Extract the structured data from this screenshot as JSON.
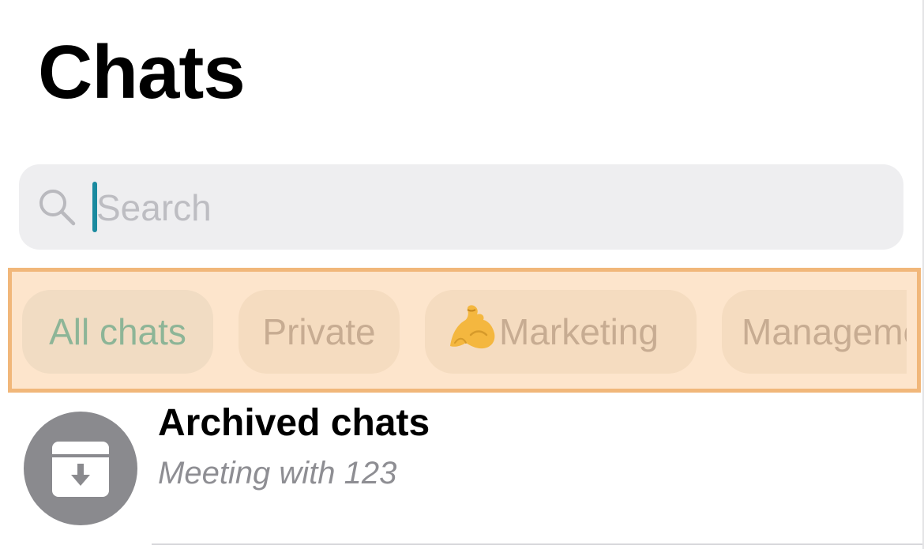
{
  "header": {
    "title": "Chats"
  },
  "search": {
    "placeholder": "Search",
    "value": ""
  },
  "filters": {
    "items": [
      {
        "label": "All chats",
        "active": true,
        "icon": ""
      },
      {
        "label": "Private",
        "active": false,
        "icon": ""
      },
      {
        "label": "Marketing",
        "active": false,
        "icon": "flexed-biceps-emoji"
      },
      {
        "label": "Management",
        "active": false,
        "icon": ""
      }
    ]
  },
  "archived": {
    "title": "Archived chats",
    "subtitle": "Meeting with 123",
    "icon": "archive-box-icon"
  },
  "colors": {
    "accent_caret": "#1a8a9f",
    "highlight_fill": "#fde5cc",
    "highlight_border": "#f1b77a",
    "active_chip_text": "#8db597",
    "avatar_gray": "#8a8a8e"
  }
}
